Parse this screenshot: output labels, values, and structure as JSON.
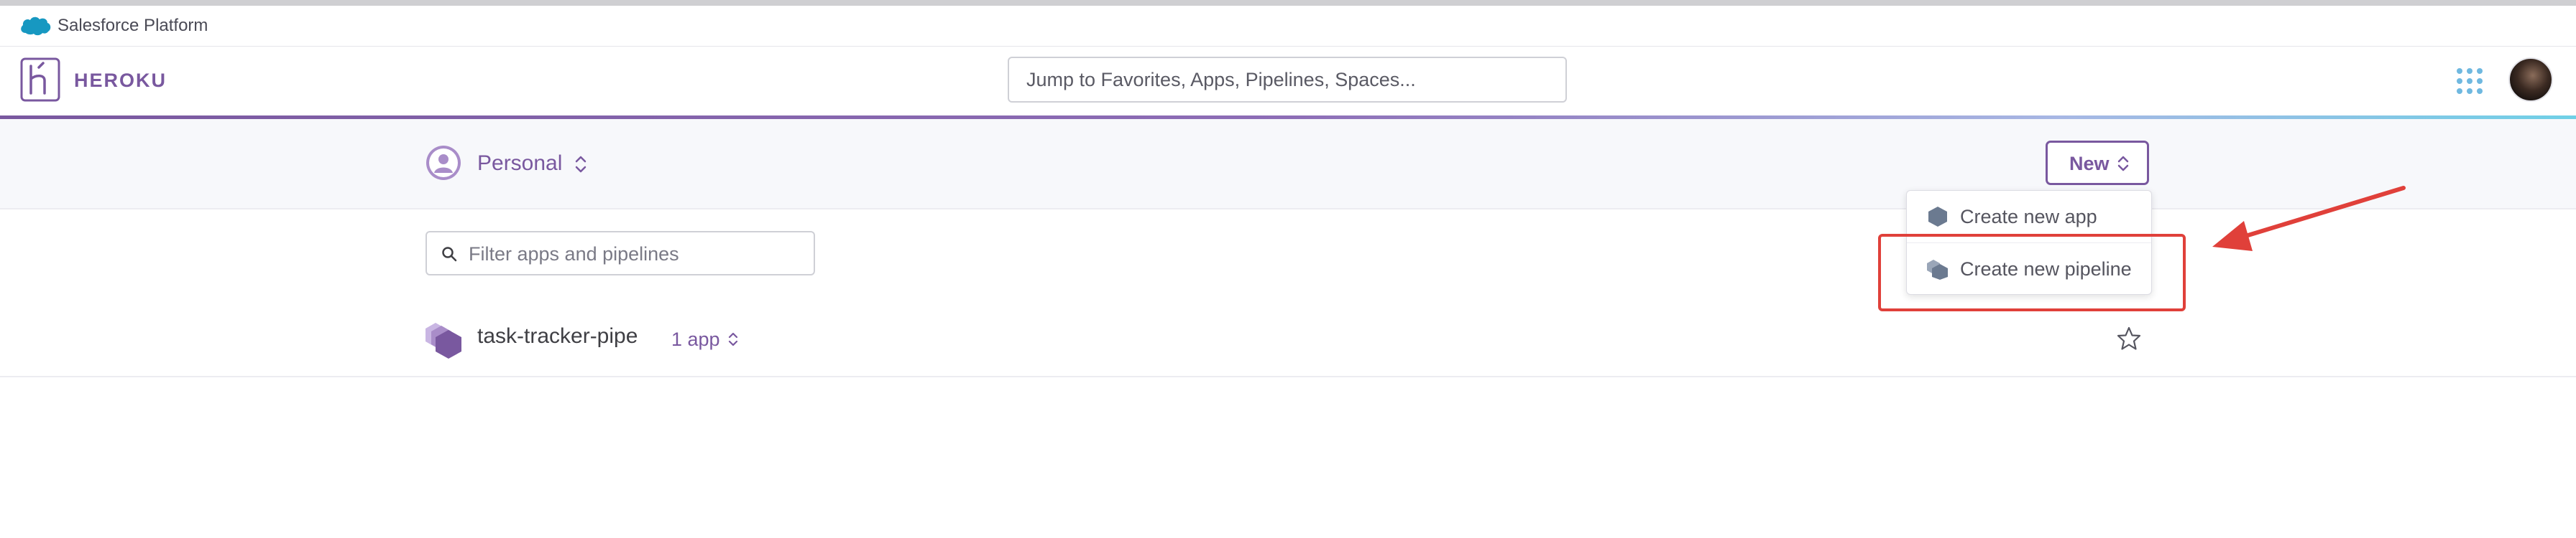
{
  "salesforce_bar": {
    "title": "Salesforce Platform",
    "icon": "salesforce-cloud-icon"
  },
  "header": {
    "brand": "HEROKU",
    "search_placeholder": "Jump to Favorites, Apps, Pipelines, Spaces..."
  },
  "account": {
    "name": "Personal"
  },
  "new_button": {
    "label": "New"
  },
  "new_menu": {
    "items": [
      {
        "label": "Create new app",
        "icon": "app-hexagon-icon"
      },
      {
        "label": "Create new pipeline",
        "icon": "pipeline-hexagons-icon"
      }
    ]
  },
  "filter": {
    "placeholder": "Filter apps and pipelines"
  },
  "pipelines": [
    {
      "name": "task-tracker-pipe",
      "count": "1 app",
      "favorite": false
    }
  ],
  "colors": {
    "brand_purple": "#79589f",
    "annotation_red": "#e0403a",
    "salesforce_blue": "#1798c1"
  }
}
